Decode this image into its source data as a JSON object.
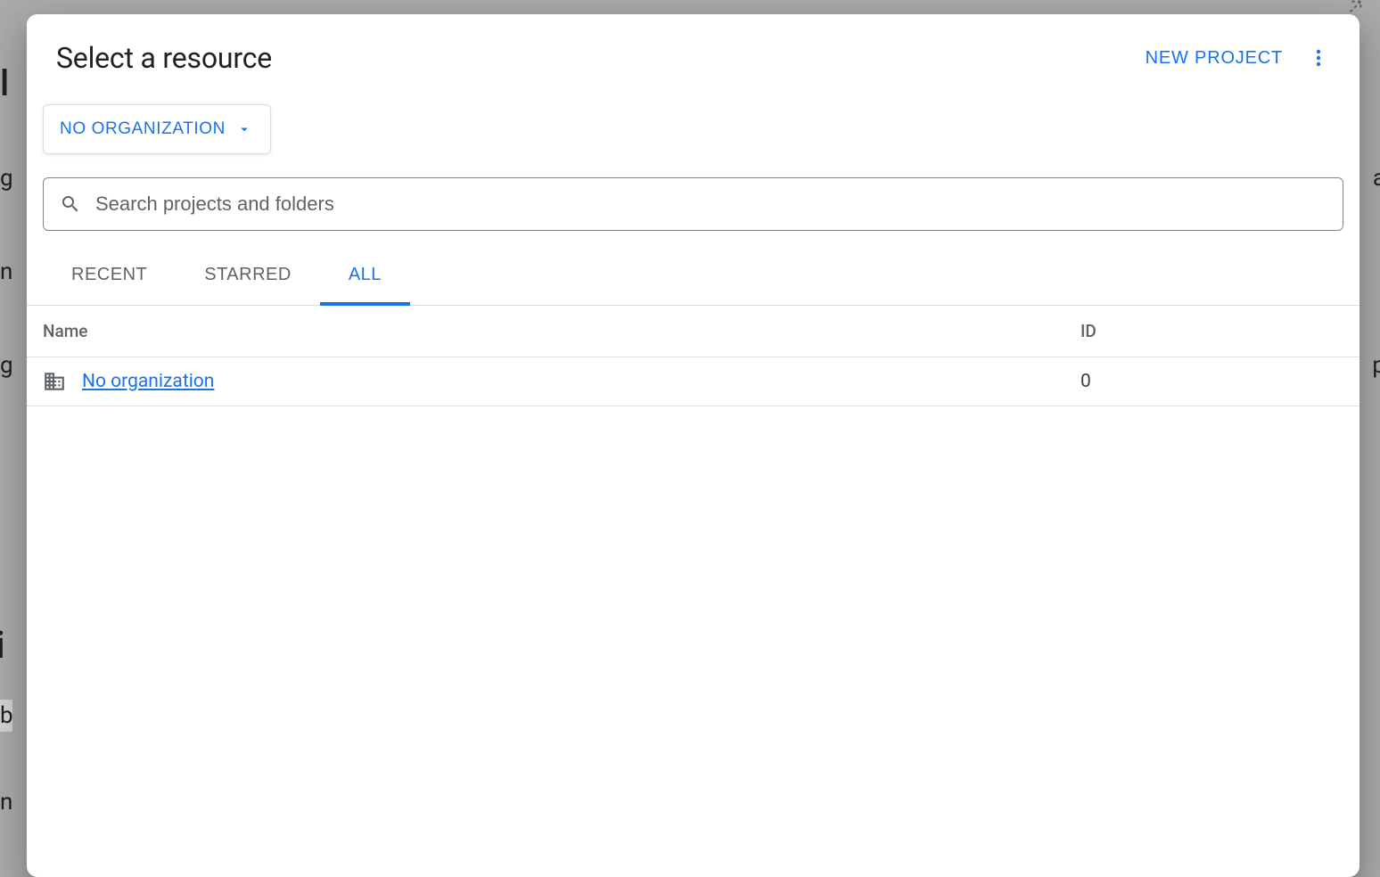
{
  "backdrop": {
    "line1": "l",
    "line2": "g",
    "line3": "n",
    "line4": "g",
    "line5": "i",
    "line6": "b",
    "line7": "n",
    "right1": "a",
    "right2": "p"
  },
  "dialog": {
    "title": "Select a resource",
    "new_project_label": "NEW PROJECT",
    "org_selector_label": "NO ORGANIZATION",
    "search_placeholder": "Search projects and folders",
    "tabs": [
      {
        "label": "RECENT"
      },
      {
        "label": "STARRED"
      },
      {
        "label": "ALL"
      }
    ],
    "columns": {
      "name": "Name",
      "id": "ID"
    },
    "rows": [
      {
        "name": "No organization",
        "id": "0"
      }
    ]
  }
}
